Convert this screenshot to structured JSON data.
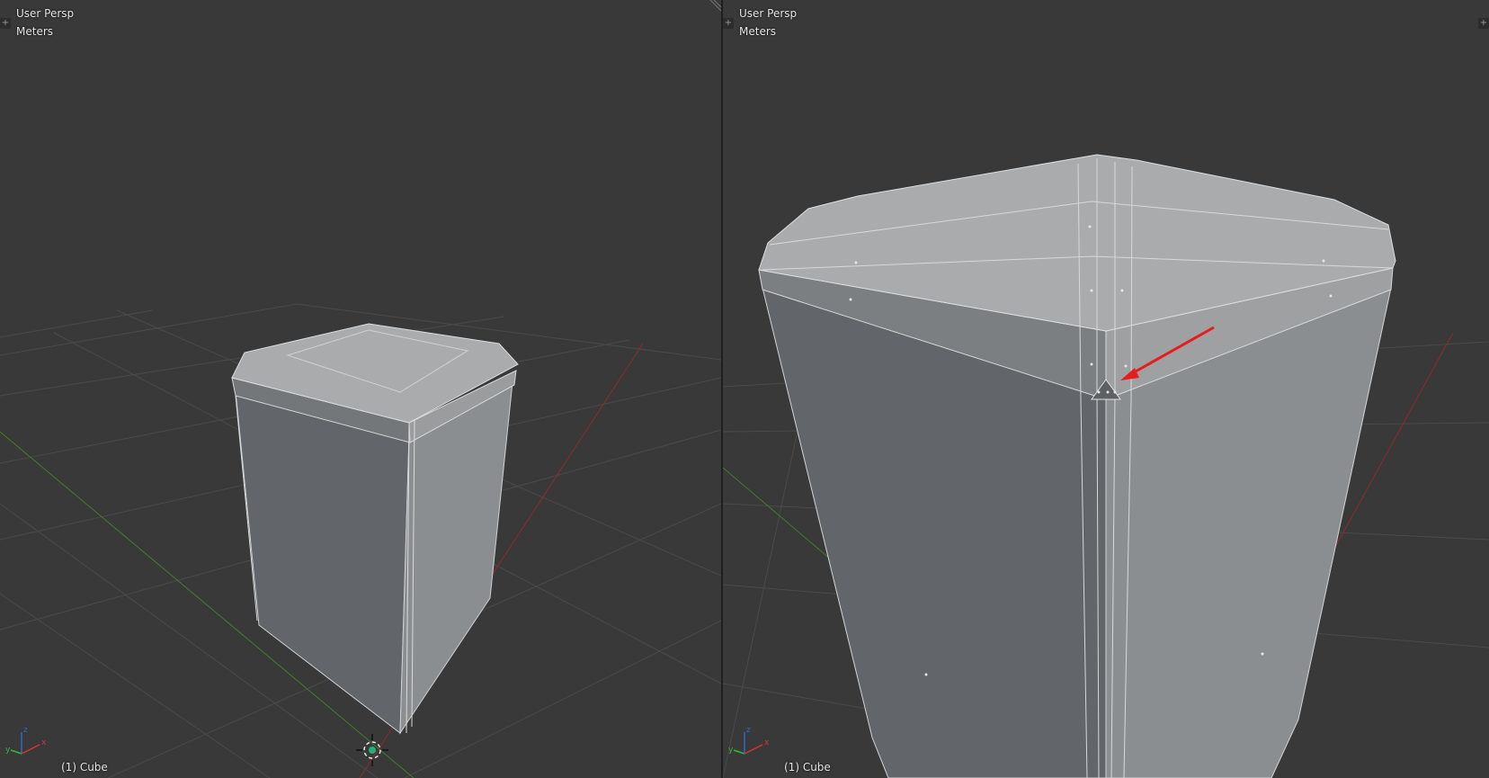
{
  "left_viewport": {
    "view_label": "User Persp",
    "units_label": "Meters",
    "object_label": "(1) Cube",
    "plus_icon": "+"
  },
  "right_viewport": {
    "view_label": "User Persp",
    "units_label": "Meters",
    "object_label": "(1) Cube",
    "plus_icon": "+"
  },
  "gizmo": {
    "x": "x",
    "y": "y",
    "z": "z"
  },
  "icons": [
    "plus-icon",
    "axis-gizmo-icon",
    "3d-cursor-icon",
    "arrow-annotation-icon",
    "corner-resize-icon"
  ],
  "colors": {
    "viewport_bg": "#393939",
    "grid": "#4a4a4a",
    "x_axis": "#8f2b2b",
    "y_axis": "#3f7f2a",
    "mesh_dark": "#626569",
    "mesh_light": "#8b8e91",
    "mesh_top": "#a9abad",
    "annotation": "#e81c1c"
  }
}
